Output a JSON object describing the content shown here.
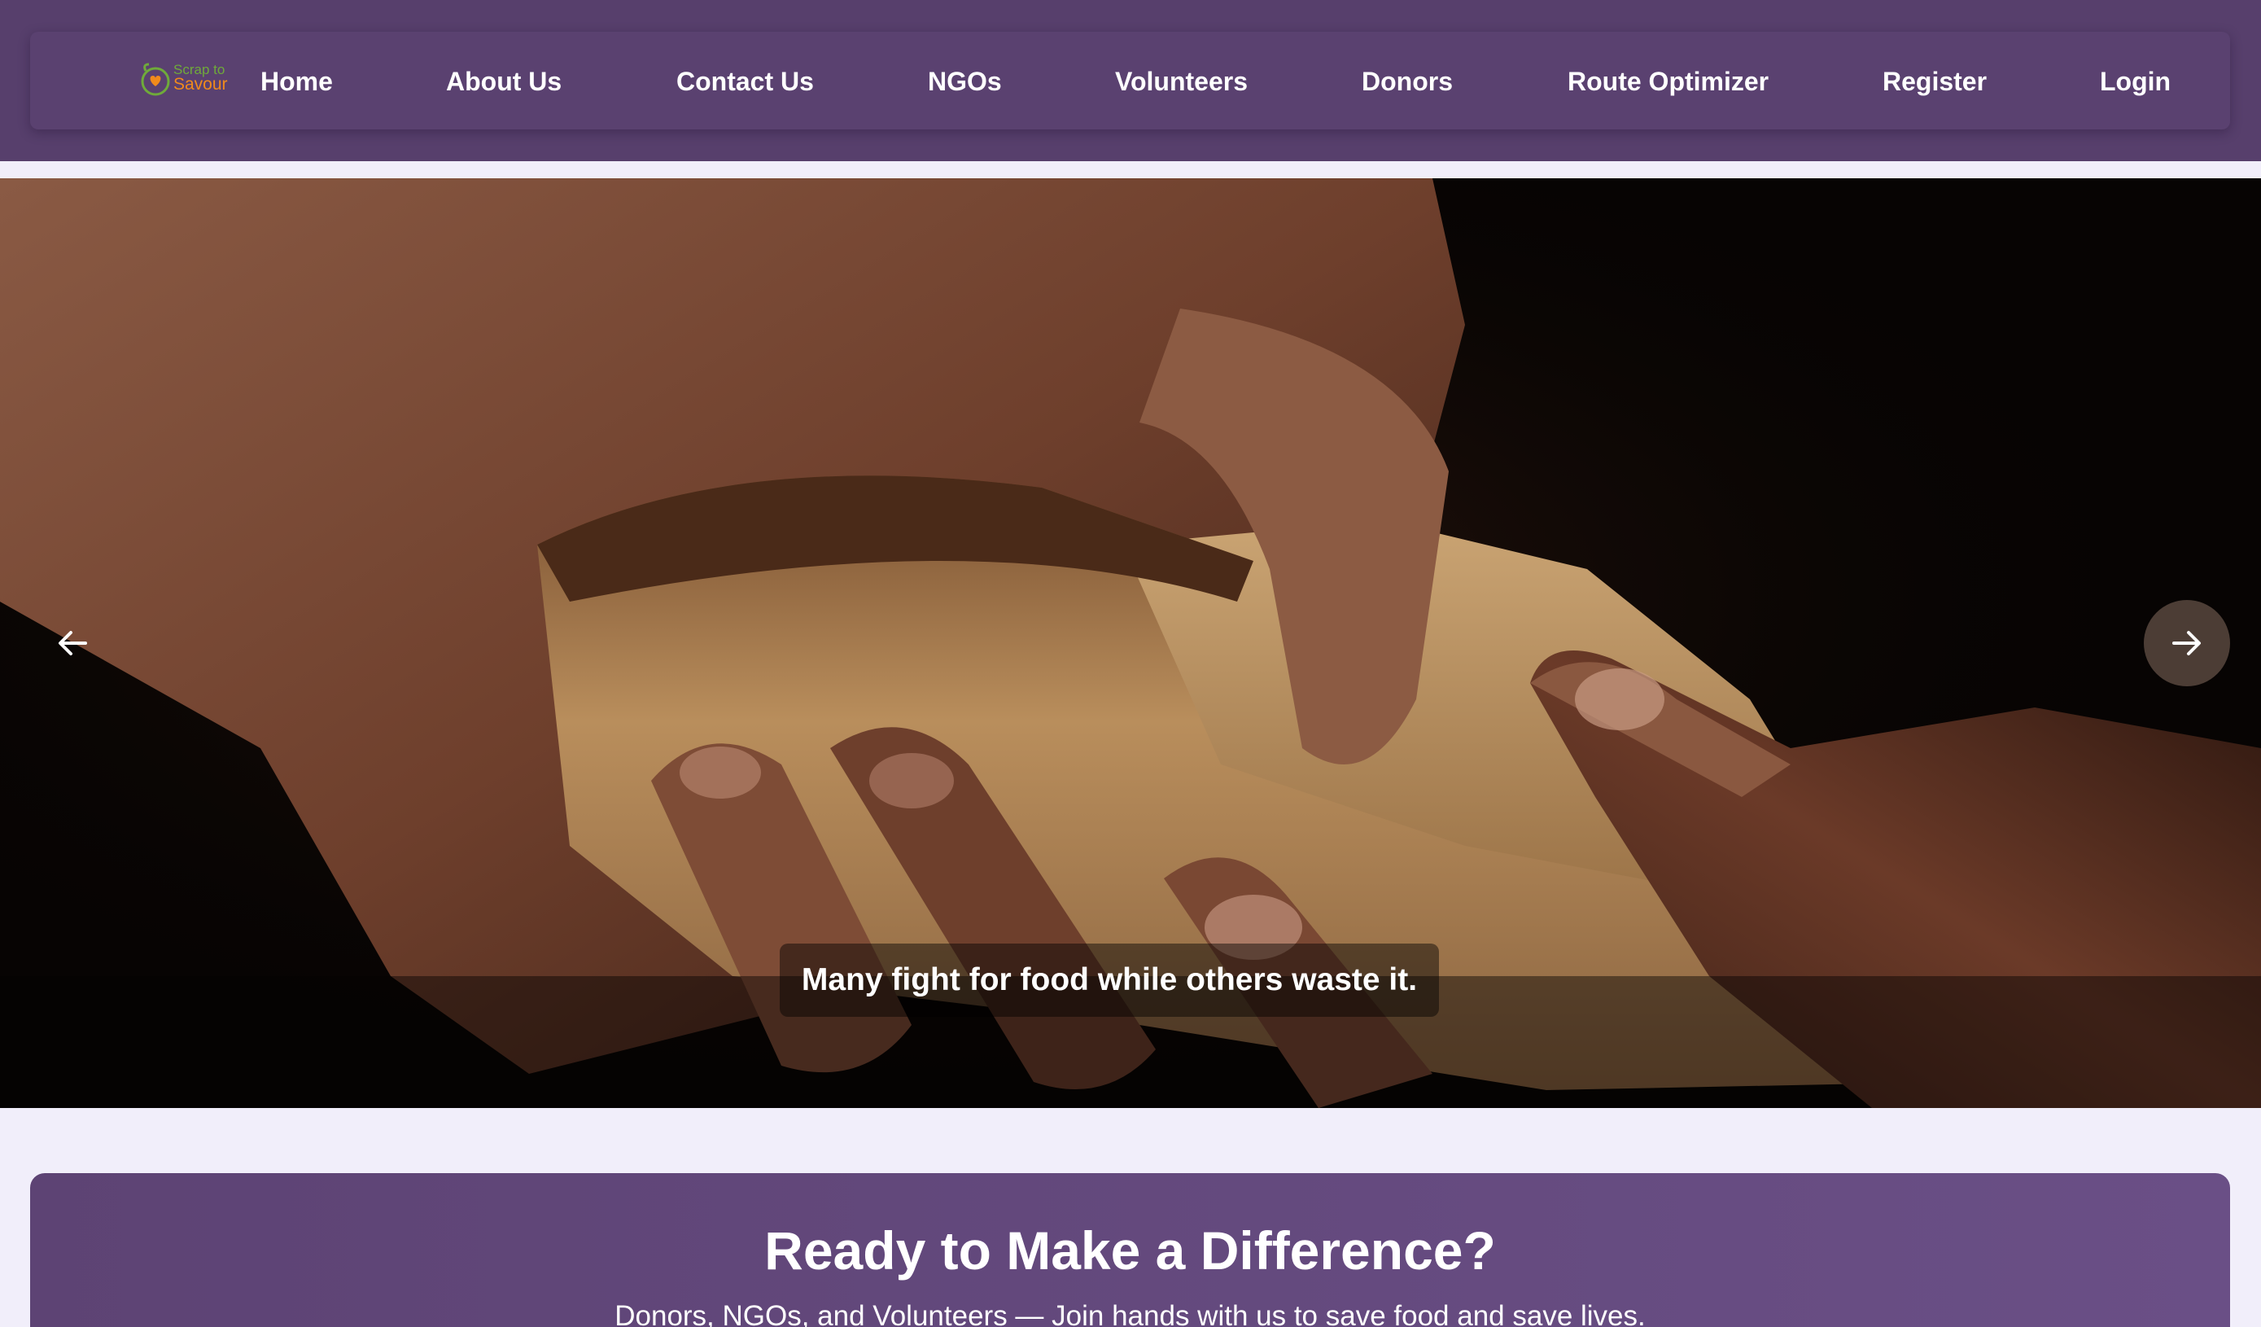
{
  "brand": {
    "logo_line1": "Scrap to",
    "logo_line2": "Savour"
  },
  "nav": {
    "items": [
      {
        "label": "Home"
      },
      {
        "label": "About Us"
      },
      {
        "label": "Contact Us"
      },
      {
        "label": "NGOs"
      },
      {
        "label": "Volunteers"
      },
      {
        "label": "Donors"
      },
      {
        "label": "Route Optimizer"
      },
      {
        "label": "Register"
      },
      {
        "label": "Login"
      }
    ]
  },
  "hero": {
    "caption": "Many fight for food while others waste it.",
    "slide_count": 4,
    "active_slide": 1
  },
  "cta": {
    "title": "Ready to Make a Difference?",
    "subtitle": "Donors, NGOs, and Volunteers — Join hands with us to save food and save lives."
  },
  "colors": {
    "header_bg": "#573f6c",
    "navbar_bg": "#5a4170",
    "cta_bg": "#64497d",
    "page_bg": "#f1eefa",
    "logo_green": "#6faa3a",
    "logo_orange": "#f08a1c"
  },
  "icons": {
    "prev": "arrow-left-icon",
    "next": "arrow-right-icon",
    "logo": "heart-plate-logo-icon"
  }
}
